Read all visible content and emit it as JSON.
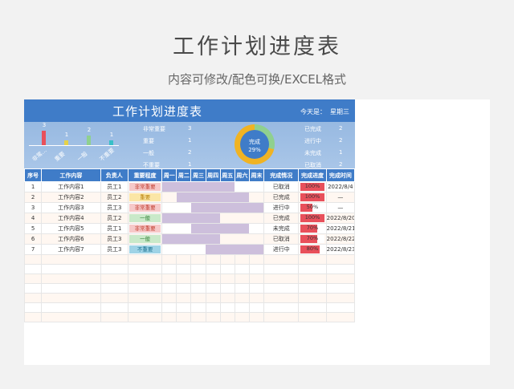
{
  "page": {
    "title": "工作计划进度表",
    "subtitle": "内容可修改/配色可换/EXCEL格式"
  },
  "dashboard": {
    "title": "工作计划进度表",
    "today_label": "今天是：",
    "today_value": "星期三",
    "priority_chart": {
      "values": [
        3,
        1,
        2,
        1
      ],
      "labels": [
        "非常...",
        "重要",
        "一般",
        "不重要"
      ],
      "colors": [
        "#e8505b",
        "#e5d24a",
        "#8fd08f",
        "#38c0c8"
      ]
    },
    "priority_counts": [
      {
        "label": "非常重要",
        "value": "3"
      },
      {
        "label": "重要",
        "value": "1"
      },
      {
        "label": "一般",
        "value": "2"
      },
      {
        "label": "不重要",
        "value": "1"
      }
    ],
    "donut": {
      "label": "完成",
      "percent": "29%",
      "fraction": 0.29
    },
    "status_counts": [
      {
        "label": "已完成",
        "value": "2"
      },
      {
        "label": "进行中",
        "value": "2"
      },
      {
        "label": "未完成",
        "value": "1"
      },
      {
        "label": "已取消",
        "value": "2"
      }
    ]
  },
  "table": {
    "headers": [
      "序号",
      "工作内容",
      "负责人",
      "重要程度",
      "周一",
      "周二",
      "周三",
      "周四",
      "周五",
      "周六",
      "周末",
      "完成情况",
      "完成进度",
      "完成时间"
    ],
    "rows": [
      {
        "no": "1",
        "content": "工作内容1",
        "owner": "员工1",
        "importance": "非常重要",
        "imp_class": "veryimportant",
        "gantt_start": 0,
        "gantt_end": 5,
        "status": "已取消",
        "progress": "100%",
        "progress_value": 1.0,
        "time": "2022/8/4"
      },
      {
        "no": "2",
        "content": "工作内容2",
        "owner": "员工2",
        "importance": "重要",
        "imp_class": "important",
        "gantt_start": 1,
        "gantt_end": 6,
        "status": "已完成",
        "progress": "100%",
        "progress_value": 1.0,
        "time": "—"
      },
      {
        "no": "3",
        "content": "工作内容3",
        "owner": "员工3",
        "importance": "非常重要",
        "imp_class": "veryimportant",
        "gantt_start": 2,
        "gantt_end": 7,
        "status": "进行中",
        "progress": "50%",
        "progress_value": 0.5,
        "time": "—"
      },
      {
        "no": "4",
        "content": "工作内容4",
        "owner": "员工2",
        "importance": "一般",
        "imp_class": "normal",
        "gantt_start": 0,
        "gantt_end": 4,
        "status": "已完成",
        "progress": "100%",
        "progress_value": 1.0,
        "time": "2022/8/20"
      },
      {
        "no": "5",
        "content": "工作内容5",
        "owner": "员工1",
        "importance": "非常重要",
        "imp_class": "veryimportant",
        "gantt_start": 2,
        "gantt_end": 6,
        "status": "未完成",
        "progress": "70%",
        "progress_value": 0.7,
        "time": "2022/8/21"
      },
      {
        "no": "6",
        "content": "工作内容6",
        "owner": "员工3",
        "importance": "一般",
        "imp_class": "normal",
        "gantt_start": 0,
        "gantt_end": 4,
        "status": "已取消",
        "progress": "70%",
        "progress_value": 0.7,
        "time": "2022/8/22"
      },
      {
        "no": "7",
        "content": "工作内容7",
        "owner": "员工3",
        "importance": "不重要",
        "imp_class": "unimportant",
        "gantt_start": 3,
        "gantt_end": 7,
        "status": "进行中",
        "progress": "80%",
        "progress_value": 0.8,
        "time": "2022/8/23"
      }
    ],
    "empty_rows": 7
  }
}
